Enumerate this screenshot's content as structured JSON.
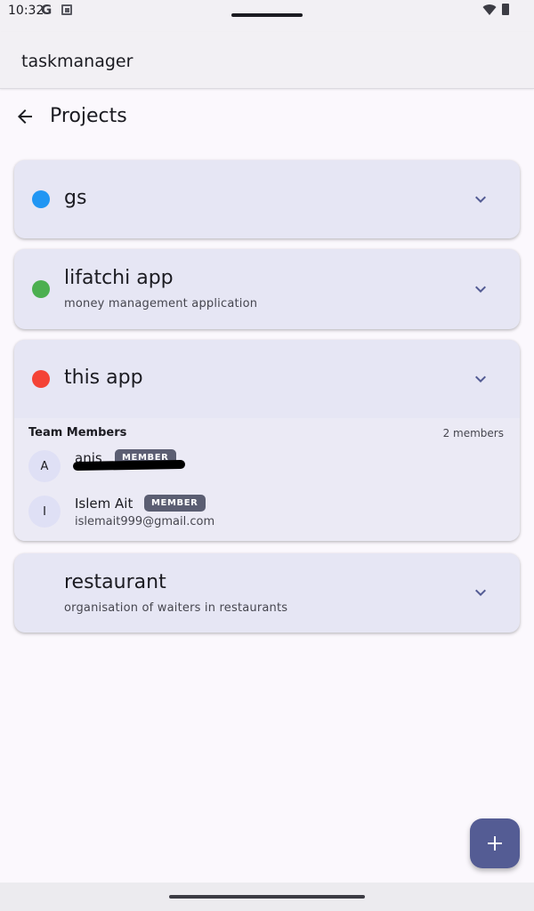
{
  "status_bar": {
    "time": "10:32",
    "google_icon": "G",
    "icons": [
      "google-icon",
      "screenshot-icon",
      "wifi-icon",
      "battery-icon"
    ]
  },
  "app_bar": {
    "title": "taskmanager"
  },
  "header": {
    "title": "Projects",
    "back_icon": "arrow-back-icon"
  },
  "projects": [
    {
      "name": "gs",
      "description": "",
      "color": "#2196f3",
      "expanded": false
    },
    {
      "name": "lifatchi app",
      "description": "money management application",
      "color": "#4caf50",
      "expanded": false
    },
    {
      "name": "this app",
      "description": "",
      "color": "#f44336",
      "expanded": true,
      "team": {
        "label": "Team Members",
        "count": "2 members",
        "members": [
          {
            "initial": "A",
            "name": "anis",
            "role": "MEMBER",
            "email": ""
          },
          {
            "initial": "I",
            "name": "Islem Ait",
            "role": "MEMBER",
            "email": "islemait999@gmail.com"
          }
        ]
      }
    },
    {
      "name": "restaurant",
      "description": "organisation of waiters in restaurants",
      "color": "",
      "expanded": false
    }
  ],
  "fab": {
    "icon": "plus-icon"
  },
  "colors": {
    "accent": "#545c94",
    "card": "#e6e6f4",
    "badge": "#5b5e72"
  }
}
